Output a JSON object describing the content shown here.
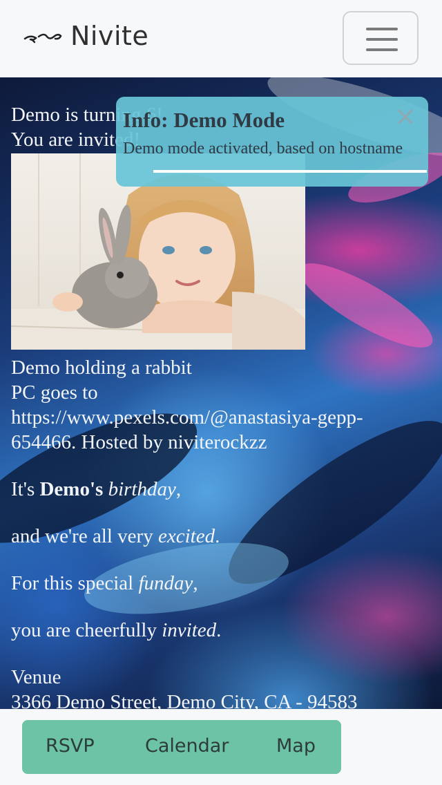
{
  "navbar": {
    "brand_name": "Nivite",
    "logo_icon": "nivite-squiggle-logo",
    "menu_icon": "hamburger-menu-icon"
  },
  "content": {
    "intro_line1": "Demo is turning 6!",
    "intro_line2": "You are invited!",
    "photo_icon": "girl-with-rabbit-photo",
    "caption_line1": "Demo holding a rabbit",
    "caption_line2": "PC goes to",
    "caption_line3": "https://www.pexels.com/@anastasiya-gepp-",
    "caption_line4": "654466. Hosted by niviterockzz",
    "verse1_pre": "It's ",
    "verse1_bold": "Demo's",
    "verse1_italic": "birthday",
    "verse1_post": ",",
    "verse2_pre": "and we're all very ",
    "verse2_italic": "excited",
    "verse2_post": ".",
    "verse3_pre": "For this special ",
    "verse3_italic": "funday",
    "verse3_post": ",",
    "verse4_pre": "you are cheerfully ",
    "verse4_italic": "invited",
    "verse4_post": ".",
    "venue_label": "Venue",
    "venue_address": "3366 Demo Street, Demo City, CA - 94583"
  },
  "toast": {
    "title": "Info: Demo Mode",
    "body": "Demo mode activated, based on hostname",
    "close_icon": "close-x-icon",
    "progress": 0.88
  },
  "actions": {
    "rsvp": "RSVP",
    "calendar": "Calendar",
    "map": "Map"
  },
  "colors": {
    "toast_bg": "#68c4d6",
    "action_bar_bg": "#6cc3a6",
    "navbar_bg": "#f7f8fa"
  }
}
